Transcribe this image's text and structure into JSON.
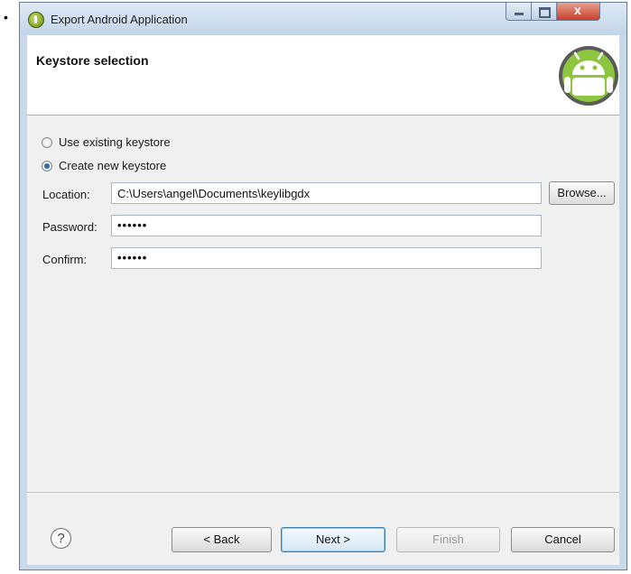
{
  "window": {
    "title": "Export Android Application"
  },
  "header": {
    "title": "Keystore selection"
  },
  "options": {
    "use_existing": {
      "label": "Use existing keystore",
      "checked": false
    },
    "create_new": {
      "label": "Create new keystore",
      "checked": true
    }
  },
  "form": {
    "location_label": "Location:",
    "location_value": "C:\\Users\\angel\\Documents\\keylibgdx",
    "browse_label": "Browse...",
    "password_label": "Password:",
    "password_value": "••••••",
    "confirm_label": "Confirm:",
    "confirm_value": "••••••"
  },
  "footer": {
    "help_symbol": "?",
    "back_label": "< Back",
    "next_label": "Next >",
    "finish_label": "Finish",
    "cancel_label": "Cancel"
  },
  "icons": [
    "help-icon",
    "android-logo-icon",
    "minimize-icon",
    "maximize-icon",
    "close-icon"
  ],
  "colors": {
    "accent": "#2b6aa8",
    "close_button": "#c8402a",
    "android_green": "#8cc63f"
  }
}
